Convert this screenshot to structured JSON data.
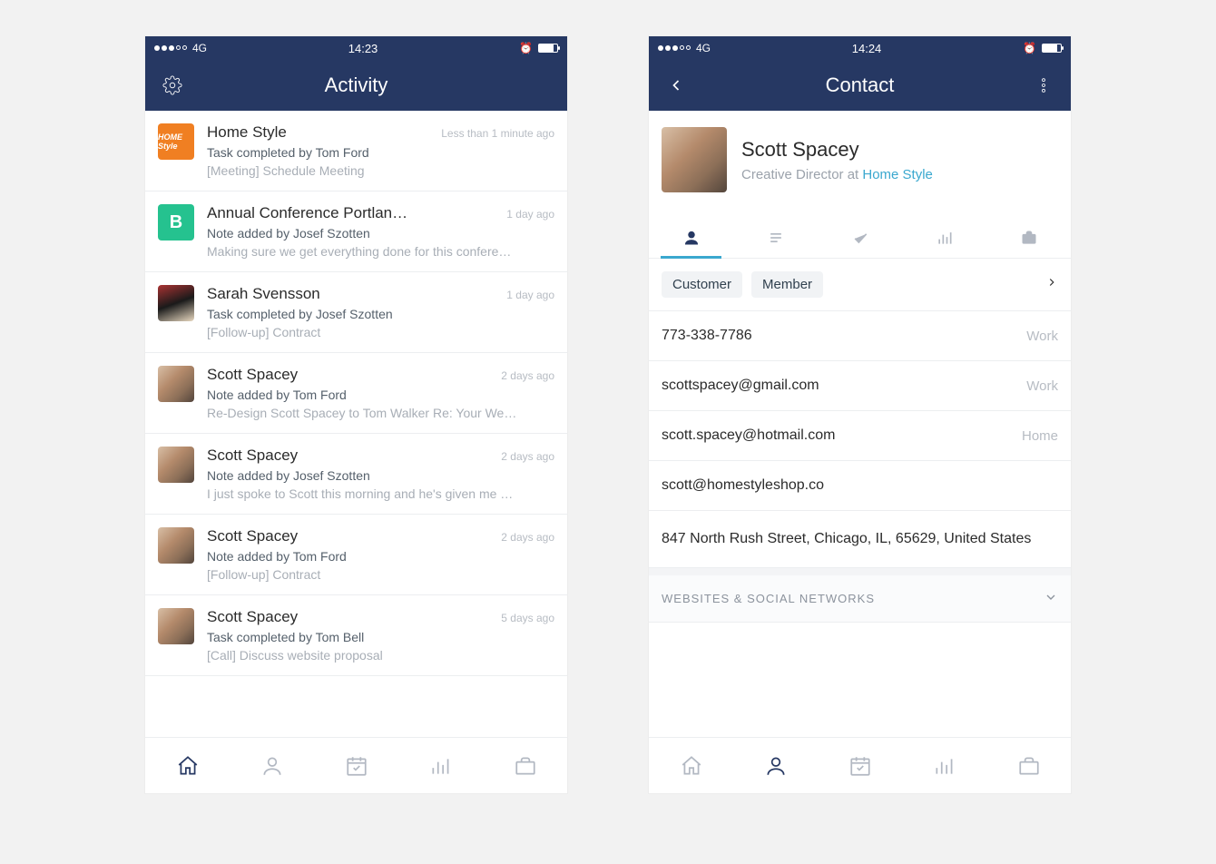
{
  "left": {
    "status": {
      "network": "4G",
      "time": "14:23"
    },
    "title": "Activity",
    "items": [
      {
        "avatarType": "orange",
        "avatarText": "HOME Style",
        "title": "Home Style",
        "time": "Less than 1 minute ago",
        "sub": "Task completed by Tom Ford",
        "meta": "[Meeting] Schedule Meeting"
      },
      {
        "avatarType": "green",
        "avatarText": "B",
        "title": "Annual Conference Portlan…",
        "time": "1 day ago",
        "sub": "Note added by Josef Szotten",
        "meta": "Making sure we get everything done for this confere…"
      },
      {
        "avatarType": "photo2",
        "avatarText": "",
        "title": "Sarah Svensson",
        "time": "1 day ago",
        "sub": "Task completed by Josef Szotten",
        "meta": "[Follow-up] Contract"
      },
      {
        "avatarType": "photo",
        "avatarText": "",
        "title": "Scott Spacey",
        "time": "2 days ago",
        "sub": "Note added by Tom Ford",
        "meta": "Re-Design Scott Spacey to Tom Walker Re: Your We…"
      },
      {
        "avatarType": "photo",
        "avatarText": "",
        "title": "Scott Spacey",
        "time": "2 days ago",
        "sub": "Note added by Josef Szotten",
        "meta": "I just spoke to Scott this morning and he's given me …"
      },
      {
        "avatarType": "photo",
        "avatarText": "",
        "title": "Scott Spacey",
        "time": "2 days ago",
        "sub": "Note added by Tom Ford",
        "meta": "[Follow-up] Contract"
      },
      {
        "avatarType": "photo",
        "avatarText": "",
        "title": "Scott Spacey",
        "time": "5 days ago",
        "sub": "Task completed by Tom Bell",
        "meta": "[Call] Discuss website proposal"
      }
    ],
    "tabs": [
      "home",
      "contacts",
      "calendar",
      "stats",
      "case"
    ],
    "activeTab": 0
  },
  "right": {
    "status": {
      "network": "4G",
      "time": "14:24"
    },
    "title": "Contact",
    "profile": {
      "name": "Scott Spacey",
      "role_prefix": "Creative Director at ",
      "role_link": "Home Style"
    },
    "segActive": 0,
    "tags": [
      "Customer",
      "Member"
    ],
    "info": [
      {
        "value": "773-338-7786",
        "label": "Work"
      },
      {
        "value": "scottspacey@gmail.com",
        "label": "Work"
      },
      {
        "value": "scott.spacey@hotmail.com",
        "label": "Home"
      },
      {
        "value": "scott@homestyleshop.co",
        "label": ""
      }
    ],
    "address": "847 North Rush Street, Chicago, IL, 65629, United States",
    "section": "WEBSITES & SOCIAL NETWORKS",
    "tabs": [
      "home",
      "contacts",
      "calendar",
      "stats",
      "case"
    ],
    "activeTab": 1
  }
}
